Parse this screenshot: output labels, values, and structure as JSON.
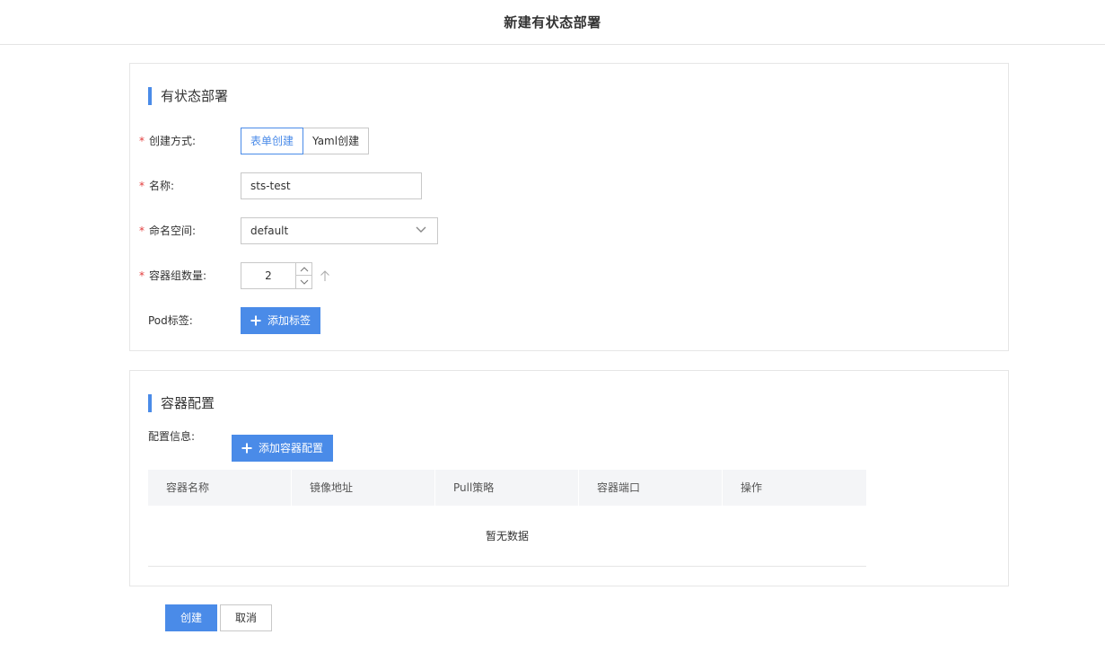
{
  "header": {
    "title": "新建有状态部署"
  },
  "basic": {
    "section_title": "有状态部署",
    "create_mode": {
      "label": "创建方式:",
      "options": [
        "表单创建",
        "Yaml创建"
      ],
      "selected": "表单创建"
    },
    "name": {
      "label": "名称:",
      "value": "sts-test"
    },
    "namespace": {
      "label": "命名空间:",
      "value": "default"
    },
    "replicas": {
      "label": "容器组数量:",
      "value": "2"
    },
    "pod_labels": {
      "label": "Pod标签:",
      "add_button": "添加标签"
    }
  },
  "container": {
    "section_title": "容器配置",
    "config_label": "配置信息:",
    "add_button": "添加容器配置",
    "table": {
      "columns": [
        "容器名称",
        "镜像地址",
        "Pull策略",
        "容器端口",
        "操作"
      ],
      "empty_text": "暂无数据"
    }
  },
  "footer": {
    "create_label": "创建",
    "cancel_label": "取消"
  },
  "colors": {
    "accent": "#4a8be8",
    "required": "#e23c3c"
  },
  "icons": {
    "select": "chevron-down-icon",
    "stepper_up": "chevron-up-icon",
    "stepper_down": "chevron-down-icon",
    "sort": "arrow-up-icon",
    "add": "plus-icon"
  }
}
